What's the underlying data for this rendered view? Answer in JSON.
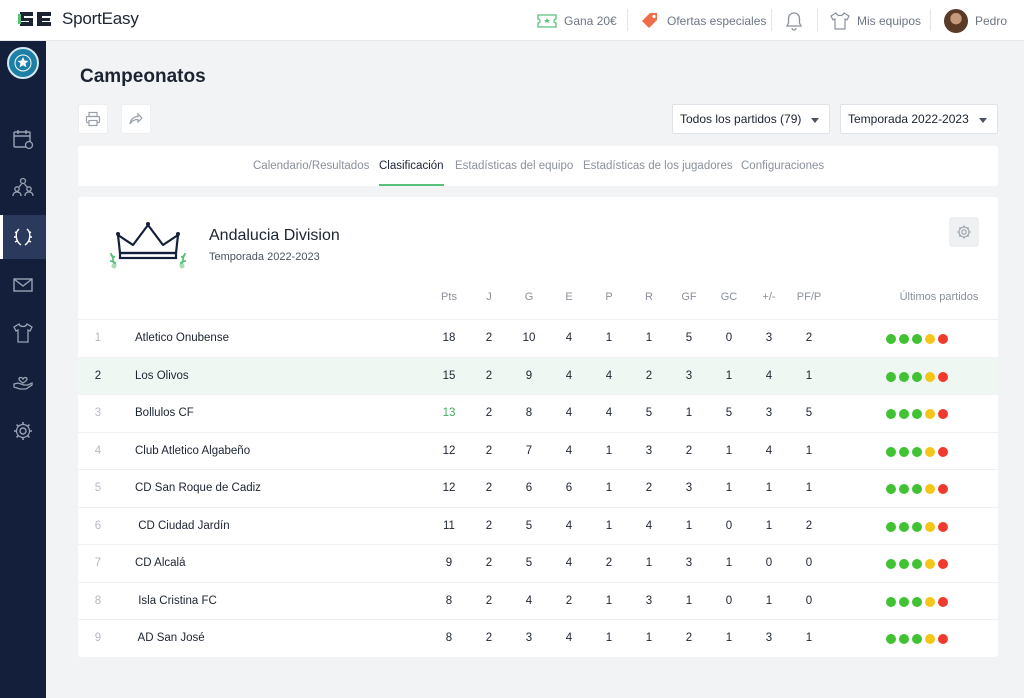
{
  "app": {
    "brand": "SportEasy",
    "colors": {
      "accent": "#59c07a",
      "sidebar": "#14203b",
      "win": "#41c233",
      "draw": "#f5c518",
      "loss": "#ef3a2d"
    }
  },
  "topbar": {
    "earn": "Gana 20€",
    "offers": "Ofertas especiales",
    "teams": "Mis equipos",
    "user": "Pedro"
  },
  "sidebar": {
    "items": [
      {
        "icon": "calendar-icon"
      },
      {
        "icon": "members-icon"
      },
      {
        "icon": "laurel-icon",
        "active": true
      },
      {
        "icon": "mail-icon"
      },
      {
        "icon": "jersey-icon"
      },
      {
        "icon": "hand-heart-icon"
      },
      {
        "icon": "gear-icon"
      }
    ]
  },
  "page": {
    "title": "Campeonatos",
    "filter_matches": "Todos los partidos (79)",
    "filter_season": "Temporada 2022-2023"
  },
  "tabs": [
    {
      "label": "Calendario/Resultados"
    },
    {
      "label": "Clasificación",
      "active": true
    },
    {
      "label": "Estadísticas del equipo"
    },
    {
      "label": "Estadísticas de los jugadores"
    },
    {
      "label": "Configuraciones"
    }
  ],
  "division": {
    "name": "Andalucia Division",
    "season": "Temporada 2022-2023"
  },
  "table": {
    "headers": [
      "Pts",
      "J",
      "G",
      "E",
      "P",
      "R",
      "GF",
      "GC",
      "+/-",
      "PF/P",
      "Últimos partidos"
    ],
    "rows": [
      {
        "rank": "1",
        "team": "Atletico Onubense",
        "vals": [
          "18",
          "2",
          "10",
          "4",
          "1",
          "1",
          "5",
          "0",
          "3",
          "2"
        ],
        "form": [
          "W",
          "W",
          "W",
          "D",
          "L"
        ]
      },
      {
        "rank": "2",
        "team": "Los Olivos",
        "vals": [
          "15",
          "2",
          "9",
          "4",
          "4",
          "2",
          "3",
          "1",
          "4",
          "1"
        ],
        "form": [
          "W",
          "W",
          "W",
          "D",
          "L"
        ],
        "highlight": true
      },
      {
        "rank": "3",
        "team": "Bollulos CF",
        "vals": [
          "13",
          "2",
          "8",
          "4",
          "4",
          "5",
          "1",
          "5",
          "3",
          "5"
        ],
        "form": [
          "W",
          "W",
          "W",
          "D",
          "L"
        ],
        "pts_green": true
      },
      {
        "rank": "4",
        "team": "Club Atletico Algabeño",
        "vals": [
          "12",
          "2",
          "7",
          "4",
          "1",
          "3",
          "2",
          "1",
          "4",
          "1"
        ],
        "form": [
          "W",
          "W",
          "W",
          "D",
          "L"
        ]
      },
      {
        "rank": "5",
        "team": "CD San Roque de Cadiz",
        "vals": [
          "12",
          "2",
          "6",
          "6",
          "1",
          "2",
          "3",
          "1",
          "1",
          "1"
        ],
        "form": [
          "W",
          "W",
          "W",
          "D",
          "L"
        ]
      },
      {
        "rank": "6",
        "team": " CD Ciudad Jardín",
        "vals": [
          "11",
          "2",
          "5",
          "4",
          "1",
          "4",
          "1",
          "0",
          "1",
          "2"
        ],
        "form": [
          "W",
          "W",
          "W",
          "D",
          "L"
        ]
      },
      {
        "rank": "7",
        "team": "CD Alcalá",
        "vals": [
          "9",
          "2",
          "5",
          "4",
          "2",
          "1",
          "3",
          "1",
          "0",
          "0"
        ],
        "form": [
          "W",
          "W",
          "W",
          "D",
          "L"
        ]
      },
      {
        "rank": "8",
        "team": " Isla Cristina FC",
        "vals": [
          "8",
          "2",
          "4",
          "2",
          "1",
          "3",
          "1",
          "0",
          "1",
          "0"
        ],
        "form": [
          "W",
          "W",
          "W",
          "D",
          "L"
        ]
      },
      {
        "rank": "9",
        "team": " AD San José",
        "vals": [
          "8",
          "2",
          "3",
          "4",
          "1",
          "1",
          "2",
          "1",
          "3",
          "1"
        ],
        "form": [
          "W",
          "W",
          "W",
          "D",
          "L"
        ]
      }
    ]
  }
}
